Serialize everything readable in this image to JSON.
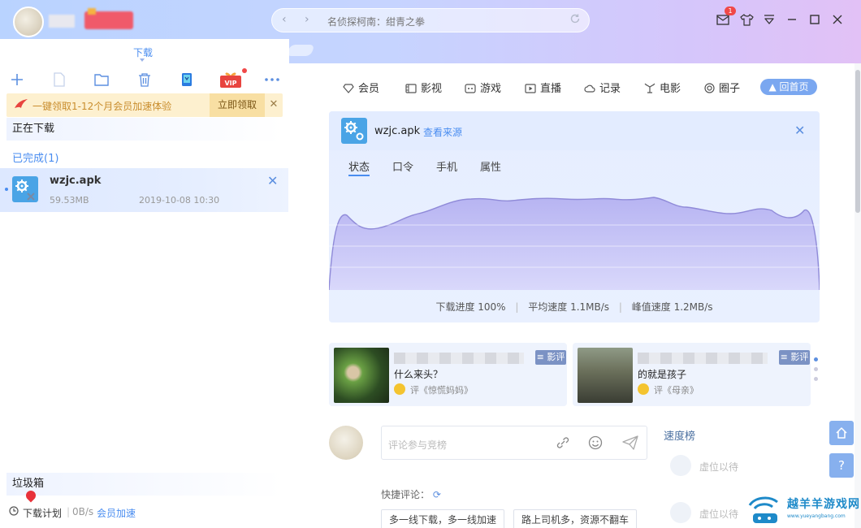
{
  "titlebar": {
    "page_title": "名侦探柯南：绀青之拳",
    "nav_back": "‹",
    "nav_forward": "›",
    "message_badge": "1"
  },
  "left": {
    "tab_label": "下载",
    "promo": {
      "text": "一键领取1-12个月会员加速体验",
      "button": "立即领取",
      "close": "✕"
    },
    "downloading_header": "正在下载",
    "completed_header": "已完成(1)",
    "completed_items": [
      {
        "name": "wzjc.apk",
        "size": "59.53MB",
        "time": "2019-10-08 10:30"
      }
    ],
    "trash_header": "垃圾箱",
    "status": {
      "plan": "下载计划",
      "speed": "0B/s",
      "vip": "会员加速"
    }
  },
  "right": {
    "nav": [
      "会员",
      "影视",
      "游戏",
      "直播",
      "记录",
      "电影",
      "圈子"
    ],
    "home_button": "回首页",
    "detail": {
      "file_name": "wzjc.apk",
      "view_source": "查看来源",
      "tabs": [
        "状态",
        "口令",
        "手机",
        "属性"
      ],
      "progress": "下载进度 100%",
      "avg_speed": "平均速度 1.1MB/s",
      "peak_speed": "峰值速度 1.2MB/s"
    },
    "reviews": [
      {
        "tag": "影评",
        "text": "什么来头？",
        "sub": "评《惊慌妈妈》"
      },
      {
        "tag": "影评",
        "text": "的就是孩子",
        "sub": "评《母亲》"
      }
    ],
    "comment": {
      "placeholder": "评论参与竞榜",
      "quick_label": "快捷评论：",
      "quick_options": [
        "多一线下载，多一线加速",
        "路上司机多，资源不翻车"
      ]
    },
    "ranking": {
      "title": "速度榜",
      "items": [
        "虚位以待",
        "虚位以待"
      ]
    }
  },
  "watermark": {
    "title": "越羊羊游戏网",
    "url": "www.yueyangbang.com"
  },
  "colors": {
    "accent": "#4a8df0",
    "promo_bg": "#fdf0cf",
    "promo_text": "#c98d2d",
    "badge": "#f04848"
  }
}
